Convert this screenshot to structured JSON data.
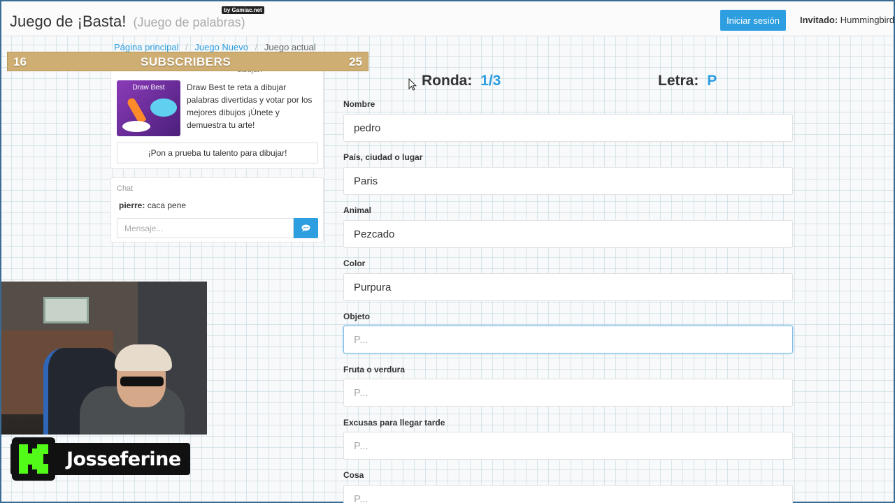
{
  "header": {
    "title": "Juego de ¡Basta!",
    "subtitle": "(Juego de palabras)",
    "by_badge": "by Gamiac.net",
    "login_label": "Iniciar sesión",
    "guest_prefix": "Invitado:",
    "guest_name": "Hummingbird"
  },
  "breadcrumb": {
    "items": [
      "Página principal",
      "Juego Nuevo"
    ],
    "current": "Juego actual"
  },
  "overlay": {
    "left_number": "16",
    "label": "SUBSCRIBERS",
    "right_number": "25",
    "streamer_name": "Josseferine"
  },
  "ad": {
    "peek_text": "dibujar!",
    "image_title": "Draw Best",
    "text": "Draw Best te reta a dibujar palabras divertidas y votar por los mejores dibujos ¡Únete y demuestra tu arte!",
    "button_label": "¡Pon a prueba tu talento para dibujar!"
  },
  "chat": {
    "title": "Chat",
    "messages": [
      {
        "user": "pierre:",
        "text": "caca pene"
      }
    ],
    "input_placeholder": "Mensaje..."
  },
  "game": {
    "round_label": "Ronda:",
    "round_value": "1/3",
    "letter_label": "Letra:",
    "letter_value": "P",
    "fields": [
      {
        "label": "Nombre",
        "value": "pedro",
        "placeholder": "P..."
      },
      {
        "label": "País, ciudad o lugar",
        "value": "Paris",
        "placeholder": "P..."
      },
      {
        "label": "Animal",
        "value": "Pezcado",
        "placeholder": "P..."
      },
      {
        "label": "Color",
        "value": "Purpura",
        "placeholder": "P..."
      },
      {
        "label": "Objeto",
        "value": "",
        "placeholder": "P..."
      },
      {
        "label": "Fruta o verdura",
        "value": "",
        "placeholder": "P..."
      },
      {
        "label": "Excusas para llegar tarde",
        "value": "",
        "placeholder": "P..."
      },
      {
        "label": "Cosa",
        "value": "",
        "placeholder": "P..."
      }
    ]
  },
  "colors": {
    "accent": "#2d9ee0",
    "banner": "#cfae73",
    "kick_green": "#53fc18"
  }
}
